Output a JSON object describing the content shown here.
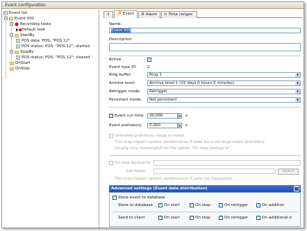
{
  "window": {
    "title": "Event configuration"
  },
  "tree": {
    "root": "Event list",
    "event": "Event 001",
    "recording": "Recording tasks",
    "default_task": "Default task",
    "startby": "StartBy",
    "startby_items": [
      "POS data; POS: \"POS 12\"",
      "POS status; POS: \"POS 12\"; started"
    ],
    "stopby": "StopBy",
    "stopby_items": [
      "POS status; POS: \"POS 12\"; cleared"
    ],
    "onstart": "OnStart",
    "onstop": "OnStop"
  },
  "tabs": {
    "info": "i",
    "event": "Event",
    "alarm": "Alarm",
    "time_ranges": "Time ranges"
  },
  "form": {
    "name_label": "Name:",
    "name_value": "Event 001",
    "description_label": "Description:",
    "description_value": "",
    "active_label": "Active",
    "type_id_label": "Event type ID:",
    "type_id_value": "2",
    "ring_buffer_label": "Ring buffer:",
    "ring_buffer_value": "Ring 1",
    "archive_level_label": "Archive level:",
    "archive_level_value": "Archive level 1 (15 days 0 hours 0 minutes)",
    "retrigger_label": "Retrigger mode:",
    "retrigger_value": "Retrigger",
    "persistent_label": "Persistent mode:",
    "persistent_value": "Not persistent",
    "run_time_label": "Event run time",
    "run_time_value": "30,000",
    "run_time_unit": "s",
    "prehistory_label": "Event prehistory:",
    "prehistory_value": "0,000",
    "prehistory_unit": "s",
    "unlimited_label": "Unlimited prehistory range to event",
    "unlimited_note1": "This may impact system performance if used for a too large event prehistory.",
    "unlimited_note2": "Usually only meaningfull for the option \"On stop backup to\".",
    "onstop_backup_label": "On stop backup to",
    "subfolder_label": "Sub folder",
    "select_button": "Select",
    "backup_note": "This may impact system performance if used too frequently!"
  },
  "advanced": {
    "title": "Advanced settings (Event data distribution)",
    "store_label": "Store event to database",
    "store_db_label": "Store to database",
    "send_label": "Send to client",
    "opts": [
      "On start",
      "On stop",
      "On retrigger",
      "On addition"
    ],
    "send_opts": [
      "On start",
      "On stop",
      "On retrigger",
      "On additional d"
    ]
  }
}
